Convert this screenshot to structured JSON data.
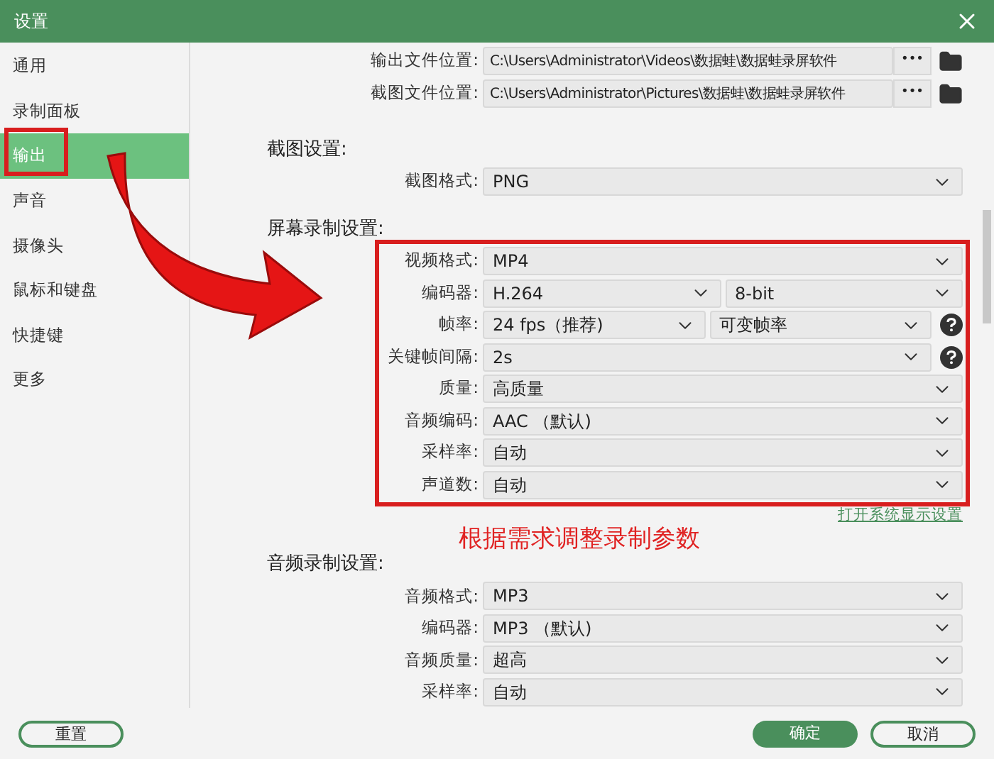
{
  "window": {
    "title": "设置"
  },
  "sidebar": {
    "items": [
      {
        "label": "通用",
        "selected": false
      },
      {
        "label": "录制面板",
        "selected": false
      },
      {
        "label": "输出",
        "selected": true
      },
      {
        "label": "声音",
        "selected": false
      },
      {
        "label": "摄像头",
        "selected": false
      },
      {
        "label": "鼠标和键盘",
        "selected": false
      },
      {
        "label": "快捷键",
        "selected": false
      },
      {
        "label": "更多",
        "selected": false
      }
    ]
  },
  "paths": [
    {
      "label": "输出文件位置:",
      "value": "C:\\Users\\Administrator\\Videos\\数据蛙\\数据蛙录屏软件",
      "button": "•••"
    },
    {
      "label": "截图文件位置:",
      "value": "C:\\Users\\Administrator\\Pictures\\数据蛙\\数据蛙录屏软件",
      "button": "•••"
    }
  ],
  "sections": [
    {
      "title": "截图设置:",
      "rows": [
        {
          "label": "截图格式:",
          "value": "PNG",
          "help": false
        }
      ]
    },
    {
      "title": "屏幕录制设置:",
      "rows": [
        {
          "label": "视频格式:",
          "value": "MP4",
          "help": false
        },
        {
          "label": "编码器:",
          "value": "H.264",
          "value_2": "8-bit",
          "help": false
        },
        {
          "label": "帧率:",
          "value": "24 fps（推荐)",
          "value_2": "可变帧率",
          "help": true
        },
        {
          "label": "关键帧间隔:",
          "value": "2s",
          "help": true
        },
        {
          "label": "质量:",
          "value": "高质量",
          "help": false
        },
        {
          "label": "音频编码:",
          "value": "AAC （默认)",
          "help": false
        },
        {
          "label": "采样率:",
          "value": "自动",
          "help": false
        },
        {
          "label": "声道数:",
          "value": "自动",
          "help": false
        }
      ],
      "link": "打开系统显示设置"
    },
    {
      "title": "音频录制设置:",
      "rows": [
        {
          "label": "音频格式:",
          "value": "MP3",
          "help": false
        },
        {
          "label": "编码器:",
          "value": "MP3 （默认)",
          "help": false
        },
        {
          "label": "音频质量:",
          "value": "超高",
          "help": false
        },
        {
          "label": "采样率:",
          "value": "自动",
          "help": false
        }
      ]
    }
  ],
  "annotation": {
    "text": "根据需求调整录制参数"
  },
  "footer": {
    "buttons": [
      {
        "label": "重置",
        "kind": "outline"
      },
      {
        "label": "确定",
        "kind": "primary"
      },
      {
        "label": "取消",
        "kind": "outline"
      }
    ]
  }
}
